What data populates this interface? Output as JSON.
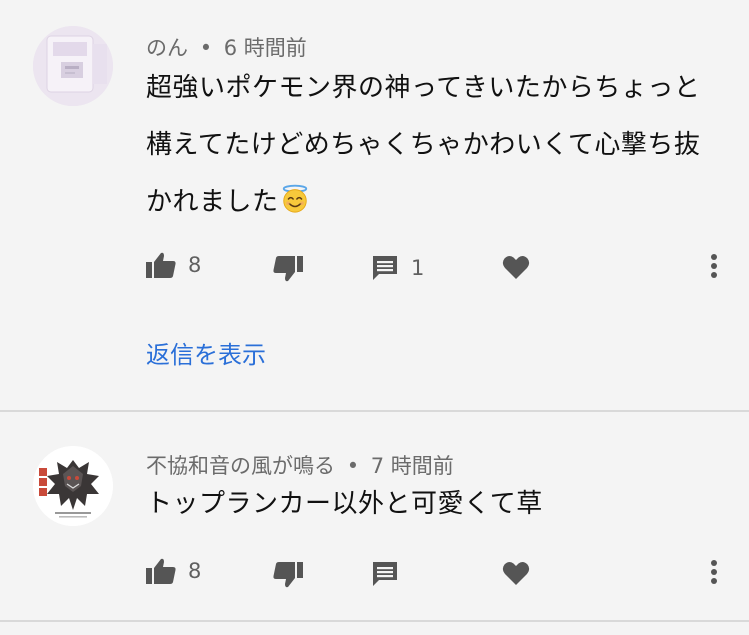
{
  "comments": [
    {
      "author": "のん",
      "separator": "•",
      "time": "6 時間前",
      "text": "超強いポケモン界の神ってきいたからちょっと構えてたけどめちゃくちゃかわいくて心撃ち抜かれました",
      "emoji": "smiling-face-with-halo",
      "likes": "8",
      "replies": "1",
      "reply_link": "返信を表示",
      "avatar_bg": "#ebe4ef"
    },
    {
      "author": "不協和音の風が鳴る",
      "separator": "•",
      "time": "7 時間前",
      "text": "トップランカー以外と可愛くて草",
      "likes": "8",
      "avatar_bg": "#ffffff"
    }
  ],
  "icons": {
    "like": "thumbs-up-icon",
    "dislike": "thumbs-down-icon",
    "reply": "comment-icon",
    "heart": "heart-icon",
    "more": "more-vertical-icon"
  },
  "colors": {
    "background": "#f4f4f4",
    "icon": "#555555",
    "meta": "#6b6b6b",
    "link": "#2a6fd8",
    "divider": "#d9d9d9"
  }
}
